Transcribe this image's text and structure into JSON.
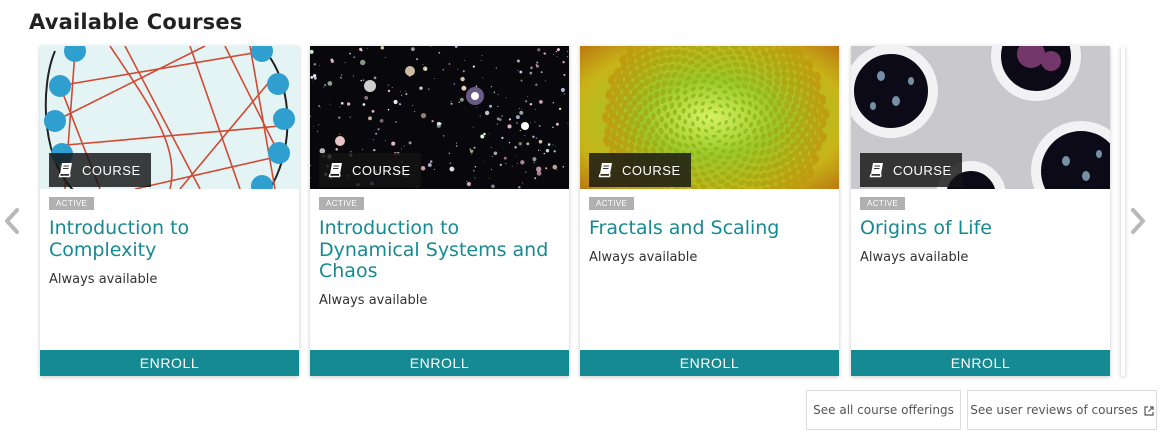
{
  "section": {
    "title": "Available Courses"
  },
  "carousel": {
    "prev_icon": "chevron-left-icon",
    "next_icon": "chevron-right-icon"
  },
  "courses": [
    {
      "type_label": "COURSE",
      "status": "ACTIVE",
      "title": "Introduction to Complexity",
      "availability": "Always available",
      "enroll_label": "ENROLL",
      "thumbnail": "network-graph-image"
    },
    {
      "type_label": "COURSE",
      "status": "ACTIVE",
      "title": "Introduction to Dynamical Systems and Chaos",
      "availability": "Always available",
      "enroll_label": "ENROLL",
      "thumbnail": "starfield-image"
    },
    {
      "type_label": "COURSE",
      "status": "ACTIVE",
      "title": "Fractals and Scaling",
      "availability": "Always available",
      "enroll_label": "ENROLL",
      "thumbnail": "sunflower-spiral-image"
    },
    {
      "type_label": "COURSE",
      "status": "ACTIVE",
      "title": "Origins of Life",
      "availability": "Always available",
      "enroll_label": "ENROLL",
      "thumbnail": "petri-dish-cells-image"
    }
  ],
  "footer": {
    "all_offerings_label": "See all course offerings",
    "user_reviews_label": "See user reviews of courses",
    "external_icon": "external-link-icon"
  },
  "colors": {
    "accent": "#168a92",
    "badge_bg": "#b0b0b0",
    "type_badge_bg": "#141414"
  }
}
